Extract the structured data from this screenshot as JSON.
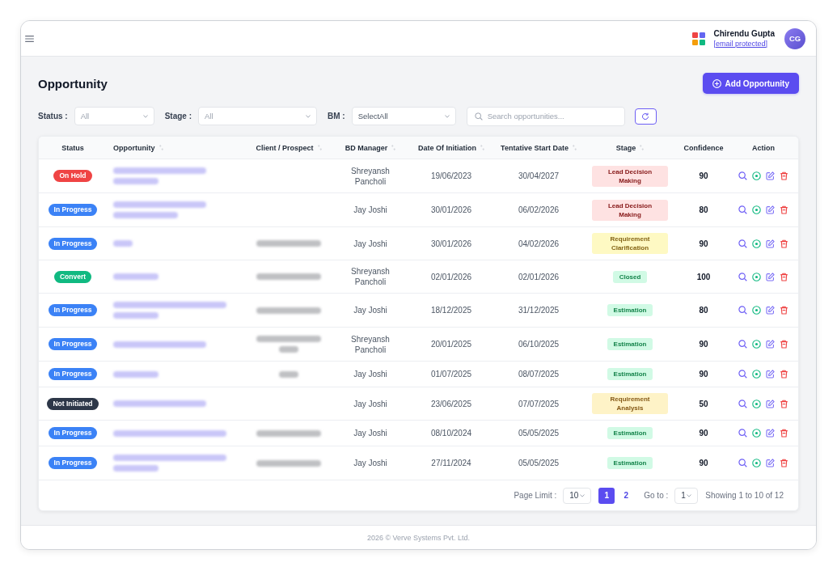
{
  "header": {
    "user": {
      "name": "Chirendu Gupta",
      "email": "[email protected]",
      "initials": "CG"
    }
  },
  "page": {
    "title": "Opportunity",
    "add_button": "Add Opportunity"
  },
  "filters": [
    {
      "label": "Status :",
      "placeholder": "All"
    },
    {
      "label": "Stage :",
      "placeholder": "All"
    },
    {
      "label": "BM :",
      "value": "SelectAll"
    }
  ],
  "search": {
    "placeholder": "Search opportunities..."
  },
  "table": {
    "columns": [
      {
        "label": "Status",
        "sortable": false
      },
      {
        "label": "Opportunity",
        "sortable": true
      },
      {
        "label": "Client / Prospect",
        "sortable": true
      },
      {
        "label": "BD Manager",
        "sortable": true
      },
      {
        "label": "Date Of Initiation",
        "sortable": true
      },
      {
        "label": "Tentative Start Date",
        "sortable": true
      },
      {
        "label": "Stage",
        "sortable": true
      },
      {
        "label": "Confidence",
        "sortable": false
      },
      {
        "label": "Action",
        "sortable": false
      }
    ],
    "rows": [
      {
        "status": {
          "label": "On Hold",
          "color": "#ef4444"
        },
        "opportunity_blur": [
          {
            "kind": "long"
          },
          {
            "kind": "short"
          }
        ],
        "client_blur": [],
        "bd_manager": "Shreyansh Pancholi",
        "date_of_initiation": "19/06/2023",
        "tentative_start_date": "30/04/2027",
        "stage": {
          "label": "Lead Decision Making",
          "color": "#fee2e2"
        },
        "confidence": "90"
      },
      {
        "status": {
          "label": "In Progress",
          "color": "#3b82f6"
        },
        "opportunity_blur": [
          {
            "kind": "long"
          },
          {
            "kind": "medium"
          }
        ],
        "client_blur": [],
        "bd_manager": "Jay Joshi",
        "date_of_initiation": "30/01/2026",
        "tentative_start_date": "06/02/2026",
        "stage": {
          "label": "Lead Decision Making",
          "color": "#fee2e2"
        },
        "confidence": "80"
      },
      {
        "status": {
          "label": "In Progress",
          "color": "#3b82f6"
        },
        "opportunity_blur": [
          {
            "kind": "tiny"
          }
        ],
        "client_blur": [
          {
            "kind": "medium"
          }
        ],
        "bd_manager": "Jay Joshi",
        "date_of_initiation": "30/01/2026",
        "tentative_start_date": "04/02/2026",
        "stage": {
          "label": "Requirement Clarification",
          "color": "#fef9c3"
        },
        "confidence": "90"
      },
      {
        "status": {
          "label": "Convert",
          "color": "#10b981"
        },
        "opportunity_blur": [
          {
            "kind": "short"
          }
        ],
        "client_blur": [
          {
            "kind": "medium"
          }
        ],
        "bd_manager": "Shreyansh Pancholi",
        "date_of_initiation": "02/01/2026",
        "tentative_start_date": "02/01/2026",
        "stage": {
          "label": "Closed",
          "color": "#d1fae5"
        },
        "confidence": "100"
      },
      {
        "status": {
          "label": "In Progress",
          "color": "#3b82f6"
        },
        "opportunity_blur": [
          {
            "kind": "full"
          },
          {
            "kind": "short"
          }
        ],
        "client_blur": [
          {
            "kind": "medium"
          }
        ],
        "bd_manager": "Jay Joshi",
        "date_of_initiation": "18/12/2025",
        "tentative_start_date": "31/12/2025",
        "stage": {
          "label": "Estimation",
          "color": "#d1fae5"
        },
        "confidence": "80"
      },
      {
        "status": {
          "label": "In Progress",
          "color": "#3b82f6"
        },
        "opportunity_blur": [
          {
            "kind": "long"
          }
        ],
        "client_blur": [
          {
            "kind": "medium"
          },
          {
            "kind": "tiny"
          }
        ],
        "bd_manager": "Shreyansh Pancholi",
        "date_of_initiation": "20/01/2025",
        "tentative_start_date": "06/10/2025",
        "stage": {
          "label": "Estimation",
          "color": "#d1fae5"
        },
        "confidence": "90"
      },
      {
        "status": {
          "label": "In Progress",
          "color": "#3b82f6"
        },
        "opportunity_blur": [
          {
            "kind": "short"
          }
        ],
        "client_blur": [
          {
            "kind": "tiny"
          }
        ],
        "bd_manager": "Jay Joshi",
        "date_of_initiation": "01/07/2025",
        "tentative_start_date": "08/07/2025",
        "stage": {
          "label": "Estimation",
          "color": "#d1fae5"
        },
        "confidence": "90"
      },
      {
        "status": {
          "label": "Not Initiated",
          "color": "#2d3748"
        },
        "opportunity_blur": [
          {
            "kind": "long"
          }
        ],
        "client_blur": [],
        "bd_manager": "Jay Joshi",
        "date_of_initiation": "23/06/2025",
        "tentative_start_date": "07/07/2025",
        "stage": {
          "label": "Requirement Analysis",
          "color": "#fef3c7"
        },
        "confidence": "50"
      },
      {
        "status": {
          "label": "In Progress",
          "color": "#3b82f6"
        },
        "opportunity_blur": [
          {
            "kind": "full"
          }
        ],
        "client_blur": [
          {
            "kind": "medium"
          }
        ],
        "bd_manager": "Jay Joshi",
        "date_of_initiation": "08/10/2024",
        "tentative_start_date": "05/05/2025",
        "stage": {
          "label": "Estimation",
          "color": "#d1fae5"
        },
        "confidence": "90"
      },
      {
        "status": {
          "label": "In Progress",
          "color": "#3b82f6"
        },
        "opportunity_blur": [
          {
            "kind": "full"
          },
          {
            "kind": "short"
          }
        ],
        "client_blur": [
          {
            "kind": "medium"
          }
        ],
        "bd_manager": "Jay Joshi",
        "date_of_initiation": "27/11/2024",
        "tentative_start_date": "05/05/2025",
        "stage": {
          "label": "Estimation",
          "color": "#d1fae5"
        },
        "confidence": "90"
      }
    ]
  },
  "pagination": {
    "page_limit_label": "Page Limit :",
    "page_limit": "10",
    "pages": [
      {
        "label": "1",
        "selected": true
      },
      {
        "label": "2",
        "selected": false
      }
    ],
    "goto_label": "Go to :",
    "goto_value": "1",
    "summary": "Showing 1 to 10 of 12"
  },
  "footer": {
    "text": "2026 © Verve Systems Pvt. Ltd."
  }
}
